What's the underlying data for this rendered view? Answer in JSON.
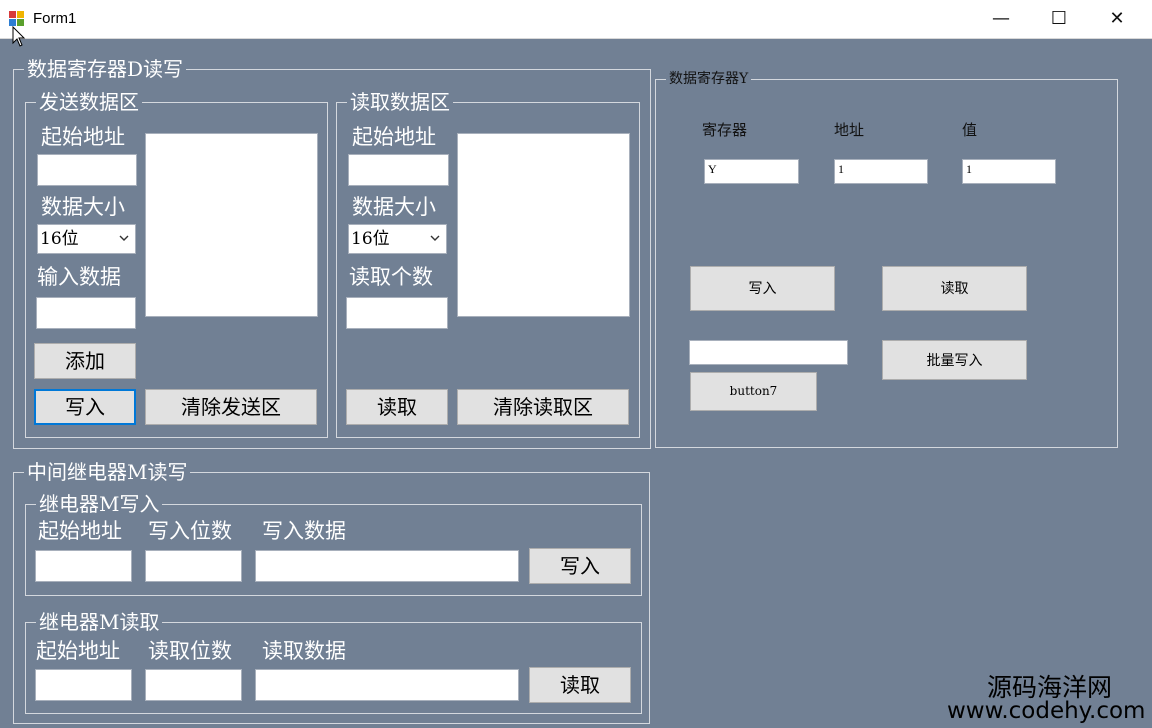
{
  "window": {
    "title": "Form1",
    "minimize_glyph": "—",
    "maximize_glyph": "☐",
    "close_glyph": "✕"
  },
  "d_register": {
    "group_title": "数据寄存器D读写",
    "send": {
      "group_title": "发送数据区",
      "start_addr_label": "起始地址",
      "data_size_label": "数据大小",
      "data_size_value": "16位",
      "input_data_label": "输入数据",
      "add_button": "添加",
      "write_button": "写入",
      "clear_button": "清除发送区"
    },
    "read": {
      "group_title": "读取数据区",
      "start_addr_label": "起始地址",
      "data_size_label": "数据大小",
      "data_size_value": "16位",
      "read_count_label": "读取个数",
      "read_button": "读取",
      "clear_button": "清除读取区"
    }
  },
  "y_register": {
    "group_title": "数据寄存器Y",
    "register_label": "寄存器",
    "address_label": "地址",
    "value_label": "值",
    "register_value": "Y",
    "address_value": "1",
    "value_value": "1",
    "write_button": "写入",
    "read_button": "读取",
    "batch_write_button": "批量写入",
    "button7": "button7"
  },
  "m_relay": {
    "group_title": "中间继电器M读写",
    "write": {
      "group_title": "继电器M写入",
      "start_addr_label": "起始地址",
      "bits_label": "写入位数",
      "data_label": "写入数据",
      "button": "写入"
    },
    "read": {
      "group_title": "继电器M读取",
      "start_addr_label": "起始地址",
      "bits_label": "读取位数",
      "data_label": "读取数据",
      "button": "读取"
    }
  },
  "watermark": {
    "line1": "源码海洋网",
    "line2": "www.codehy.com"
  }
}
